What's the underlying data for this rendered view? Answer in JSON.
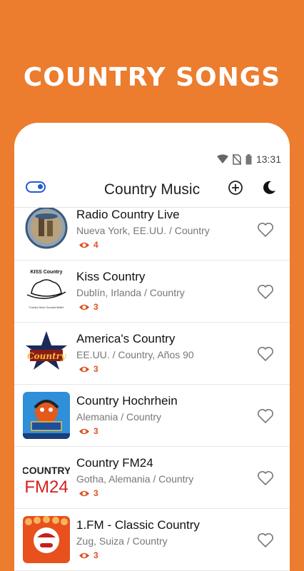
{
  "promo": {
    "title": "COUNTRY SONGS"
  },
  "status": {
    "time": "13:31"
  },
  "appbar": {
    "title": "Country Music"
  },
  "colors": {
    "background": "#EC7C2E",
    "accent_blue": "#1E5BD6",
    "views_color": "#D9531E"
  },
  "stations": [
    {
      "name": "Radio Country Live",
      "location": "Nueva York, EE.UU. / Country",
      "views": "4",
      "logo": "radio-country-live-logo"
    },
    {
      "name": "Kiss Country",
      "location": "Dublín, Irlanda / Country",
      "views": "3",
      "logo": "kiss-country-logo",
      "logo_text_top": "KISS Country",
      "logo_text_bottom": "\"Country Never Sounded Better\""
    },
    {
      "name": "America's Country",
      "location": "EE.UU. / Country, Años 90",
      "views": "3",
      "logo": "americas-country-logo",
      "logo_text": "Country"
    },
    {
      "name": "Country Hochrhein",
      "location": "Alemania / Country",
      "views": "3",
      "logo": "country-hochrhein-logo"
    },
    {
      "name": "Country FM24",
      "location": "Gotha, Alemania / Country",
      "views": "3",
      "logo": "country-fm24-logo",
      "logo_text_top": "COUNTRY",
      "logo_text_bottom": "FM24"
    },
    {
      "name": "1.FM - Classic Country",
      "location": "Zug, Suiza / Country",
      "views": "3",
      "logo": "classic-country-logo"
    }
  ]
}
